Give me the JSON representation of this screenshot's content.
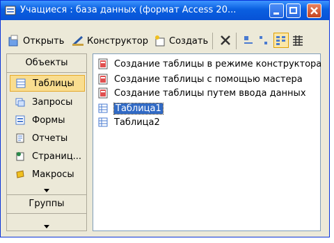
{
  "window": {
    "title": "Учащиеся : база данных (формат Access 20..."
  },
  "toolbar": {
    "open": "Открыть",
    "design": "Конструктор",
    "create": "Создать"
  },
  "pane": {
    "header": "Объекты",
    "items": [
      {
        "label": "Таблицы",
        "icon": "table-icon",
        "selected": true
      },
      {
        "label": "Запросы",
        "icon": "query-icon"
      },
      {
        "label": "Формы",
        "icon": "form-icon"
      },
      {
        "label": "Отчеты",
        "icon": "report-icon"
      },
      {
        "label": "Страниц...",
        "icon": "page-icon"
      },
      {
        "label": "Макросы",
        "icon": "macro-icon"
      }
    ],
    "groups_header": "Группы"
  },
  "list": {
    "items": [
      {
        "label": "Создание таблицы в режиме конструктора",
        "icon": "wizard-icon"
      },
      {
        "label": "Создание таблицы с помощью мастера",
        "icon": "wizard-icon"
      },
      {
        "label": "Создание таблицы путем ввода данных",
        "icon": "wizard-icon"
      },
      {
        "label": "Таблица1",
        "icon": "table-icon",
        "selected": true
      },
      {
        "label": "Таблица2",
        "icon": "table-icon"
      }
    ]
  }
}
